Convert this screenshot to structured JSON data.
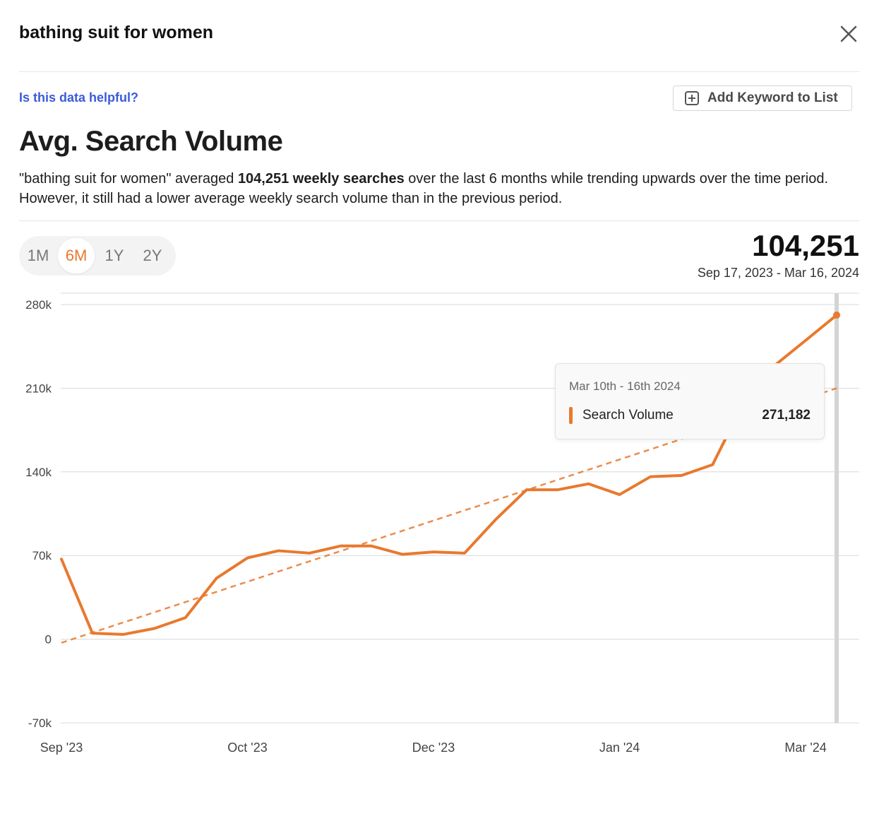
{
  "header": {
    "title": "bathing suit for women"
  },
  "feedback_link": "Is this data helpful?",
  "add_keyword_label": "Add Keyword to List",
  "section_title": "Avg. Search Volume",
  "description": {
    "part1": "\"bathing suit for women\" averaged ",
    "bold": "104,251 weekly searches",
    "part2": " over the last 6 months while trending upwards over the time period. However, it still had a lower average weekly search volume than in the previous period."
  },
  "range_tabs": [
    {
      "label": "1M",
      "active": false
    },
    {
      "label": "6M",
      "active": true
    },
    {
      "label": "1Y",
      "active": false
    },
    {
      "label": "2Y",
      "active": false
    }
  ],
  "summary": {
    "value": "104,251",
    "date_range": "Sep 17, 2023 - Mar 16, 2024"
  },
  "tooltip": {
    "date": "Mar 10th - 16th 2024",
    "series_label": "Search Volume",
    "value": "271,182"
  },
  "colors": {
    "accent": "#e8792e",
    "grid": "#d9d9d9",
    "link": "#3b5bdb"
  },
  "chart_data": {
    "type": "line",
    "ylim": [
      -70000,
      280000
    ],
    "y_ticks": [
      280000,
      210000,
      140000,
      70000,
      0,
      -70000
    ],
    "y_tick_labels": [
      "280k",
      "210k",
      "140k",
      "70k",
      "0",
      "-70k"
    ],
    "x_tick_labels": [
      "Sep '23",
      "Oct '23",
      "Dec '23",
      "Jan '24",
      "Mar '24"
    ],
    "x_ticks_week": [
      0,
      6,
      12,
      18,
      24
    ],
    "series": [
      {
        "name": "Search Volume",
        "week": [
          0,
          1,
          2,
          3,
          4,
          5,
          6,
          7,
          8,
          9,
          10,
          11,
          12,
          13,
          14,
          15,
          16,
          17,
          18,
          19,
          20,
          21,
          22,
          23,
          24,
          25
        ],
        "values": [
          67000,
          5000,
          4000,
          9000,
          18000,
          51000,
          68000,
          74000,
          72000,
          78000,
          78000,
          71000,
          73000,
          72000,
          100000,
          125000,
          125000,
          130000,
          121000,
          136000,
          137000,
          146000,
          198000,
          229000,
          250000,
          271182
        ]
      }
    ],
    "trendline": {
      "start": [
        0,
        -3000
      ],
      "end": [
        25,
        210000
      ]
    },
    "highlight_week": 25
  }
}
